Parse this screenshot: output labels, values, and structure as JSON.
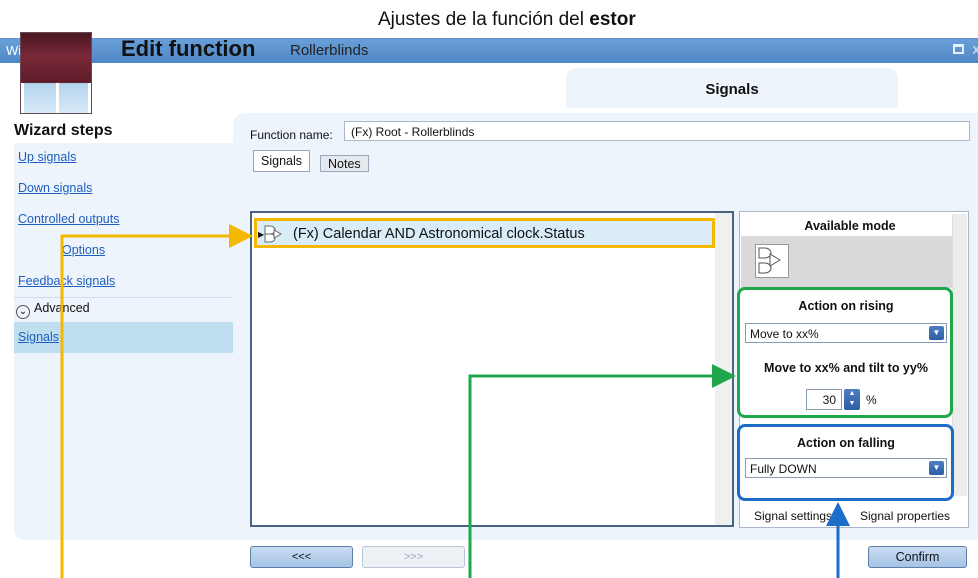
{
  "caption": {
    "prefix": "Ajustes de la función del ",
    "bold": "estor"
  },
  "window": {
    "title": "Wizard...",
    "close": "x"
  },
  "header": {
    "title": "Edit function",
    "subtitle": "Rollerblinds",
    "tab": "Signals"
  },
  "wizard_steps": {
    "title": "Wizard steps",
    "items": [
      "Up signals",
      "Down signals",
      "Controlled outputs",
      "Options",
      "Feedback signals"
    ],
    "advanced": "Advanced",
    "selected": "Signals"
  },
  "function": {
    "name_label": "Function name:",
    "name_value": "(Fx) Root - Rollerblinds"
  },
  "tabs": [
    "Signals",
    "Notes"
  ],
  "signal_row": "(Fx) Calendar AND Astronomical clock.Status",
  "right_panel": {
    "available_mode": "Available mode",
    "action_on_rising": "Action on rising",
    "rising_value": "Move to xx%",
    "move_tilt_label": "Move to xx% and tilt to yy%",
    "percent_value": "30",
    "percent_unit": "%",
    "action_on_falling": "Action on falling",
    "falling_value": "Fully DOWN",
    "bottom_tabs": [
      "Signal settings",
      "Signal properties"
    ]
  },
  "buttons": {
    "back": "<<<",
    "next": ">>>",
    "confirm": "Confirm"
  },
  "colors": {
    "yellow": "#f5b800",
    "green": "#1ea84b",
    "blue": "#1c6dc8",
    "titlebar": "#5b8ec9"
  }
}
